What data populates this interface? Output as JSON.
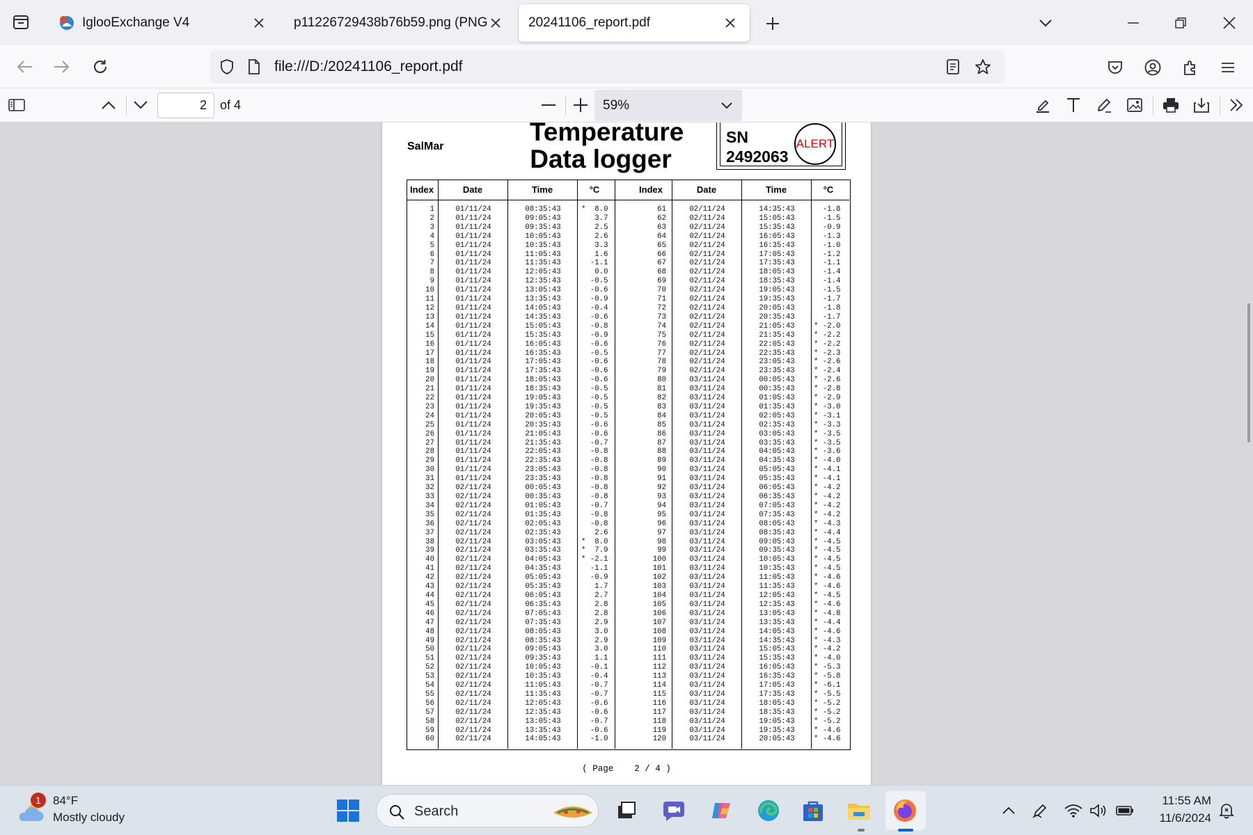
{
  "browser": {
    "tabs": [
      {
        "title": "IglooExchange V4",
        "active": false
      },
      {
        "title": "p11226729438b76b59.png (PNG Im",
        "active": false
      },
      {
        "title": "20241106_report.pdf",
        "active": true
      }
    ],
    "url": "file:///D:/20241106_report.pdf"
  },
  "pdf_toolbar": {
    "page_number": "2",
    "page_count": "of 4",
    "zoom": "59%"
  },
  "document": {
    "company": "SalMar",
    "title_line1": "Temperature",
    "title_line2": "Data logger",
    "sn_label": "SN",
    "sn_number": "2492063",
    "alert": "ALERT",
    "headers": [
      "Index",
      "Date",
      "Time",
      "°C",
      "Index",
      "Date",
      "Time",
      "°C"
    ],
    "left": {
      "index": [
        "1",
        "2",
        "3",
        "4",
        "5",
        "6",
        "7",
        "8",
        "9",
        "10",
        "11",
        "12",
        "13",
        "14",
        "15",
        "16",
        "17",
        "18",
        "19",
        "20",
        "21",
        "22",
        "23",
        "24",
        "25",
        "26",
        "27",
        "28",
        "29",
        "30",
        "31",
        "32",
        "33",
        "34",
        "35",
        "36",
        "37",
        "38",
        "39",
        "40",
        "41",
        "42",
        "43",
        "44",
        "45",
        "46",
        "47",
        "48",
        "49",
        "50",
        "51",
        "52",
        "53",
        "54",
        "55",
        "56",
        "57",
        "58",
        "59",
        "60"
      ],
      "date": [
        "01/11/24",
        "01/11/24",
        "01/11/24",
        "01/11/24",
        "01/11/24",
        "01/11/24",
        "01/11/24",
        "01/11/24",
        "01/11/24",
        "01/11/24",
        "01/11/24",
        "01/11/24",
        "01/11/24",
        "01/11/24",
        "01/11/24",
        "01/11/24",
        "01/11/24",
        "01/11/24",
        "01/11/24",
        "01/11/24",
        "01/11/24",
        "01/11/24",
        "01/11/24",
        "01/11/24",
        "01/11/24",
        "01/11/24",
        "01/11/24",
        "01/11/24",
        "01/11/24",
        "01/11/24",
        "01/11/24",
        "02/11/24",
        "02/11/24",
        "02/11/24",
        "02/11/24",
        "02/11/24",
        "02/11/24",
        "02/11/24",
        "02/11/24",
        "02/11/24",
        "02/11/24",
        "02/11/24",
        "02/11/24",
        "02/11/24",
        "02/11/24",
        "02/11/24",
        "02/11/24",
        "02/11/24",
        "02/11/24",
        "02/11/24",
        "02/11/24",
        "02/11/24",
        "02/11/24",
        "02/11/24",
        "02/11/24",
        "02/11/24",
        "02/11/24",
        "02/11/24",
        "02/11/24",
        "02/11/24"
      ],
      "time": [
        "08:35:43",
        "09:05:43",
        "09:35:43",
        "10:05:43",
        "10:35:43",
        "11:05:43",
        "11:35:43",
        "12:05:43",
        "12:35:43",
        "13:05:43",
        "13:35:43",
        "14:05:43",
        "14:35:43",
        "15:05:43",
        "15:35:43",
        "16:05:43",
        "16:35:43",
        "17:05:43",
        "17:35:43",
        "18:05:43",
        "18:35:43",
        "19:05:43",
        "19:35:43",
        "20:05:43",
        "20:35:43",
        "21:05:43",
        "21:35:43",
        "22:05:43",
        "22:35:43",
        "23:05:43",
        "23:35:43",
        "00:05:43",
        "00:35:43",
        "01:05:43",
        "01:35:43",
        "02:05:43",
        "02:35:43",
        "03:05:43",
        "03:35:43",
        "04:05:43",
        "04:35:43",
        "05:05:43",
        "05:35:43",
        "06:05:43",
        "06:35:43",
        "07:05:43",
        "07:35:43",
        "08:05:43",
        "08:35:43",
        "09:05:43",
        "09:35:43",
        "10:05:43",
        "10:35:43",
        "11:05:43",
        "11:35:43",
        "12:05:43",
        "12:35:43",
        "13:05:43",
        "13:35:43",
        "14:05:43"
      ],
      "temp": [
        "*  8.0",
        "   3.7",
        "   2.5",
        "   2.6",
        "   3.3",
        "   1.6",
        "  -1.1",
        "   0.0",
        "  -0.5",
        "  -0.6",
        "  -0.9",
        "  -0.4",
        "  -0.6",
        "  -0.8",
        "  -0.9",
        "  -0.6",
        "  -0.5",
        "  -0.6",
        "  -0.6",
        "  -0.6",
        "  -0.5",
        "  -0.5",
        "  -0.5",
        "  -0.5",
        "  -0.6",
        "  -0.6",
        "  -0.7",
        "  -0.8",
        "  -0.8",
        "  -0.8",
        "  -0.8",
        "  -0.8",
        "  -0.8",
        "  -0.7",
        "  -0.8",
        "  -0.8",
        "   2.6",
        "*  8.0",
        "*  7.9",
        "* -2.1",
        "  -1.1",
        "  -0.9",
        "   1.7",
        "   2.7",
        "   2.8",
        "   2.8",
        "   2.9",
        "   3.0",
        "   2.9",
        "   3.0",
        "   1.1",
        "  -0.1",
        "  -0.4",
        "  -0.7",
        "  -0.7",
        "  -0.6",
        "  -0.6",
        "  -0.7",
        "  -0.6",
        "  -1.0"
      ]
    },
    "right": {
      "index": [
        "61",
        "62",
        "63",
        "64",
        "65",
        "66",
        "67",
        "68",
        "69",
        "70",
        "71",
        "72",
        "73",
        "74",
        "75",
        "76",
        "77",
        "78",
        "79",
        "80",
        "81",
        "82",
        "83",
        "84",
        "85",
        "86",
        "87",
        "88",
        "89",
        "90",
        "91",
        "92",
        "93",
        "94",
        "95",
        "96",
        "97",
        "98",
        "99",
        "100",
        "101",
        "102",
        "103",
        "104",
        "105",
        "106",
        "107",
        "108",
        "109",
        "110",
        "111",
        "112",
        "113",
        "114",
        "115",
        "116",
        "117",
        "118",
        "119",
        "120"
      ],
      "date": [
        "02/11/24",
        "02/11/24",
        "02/11/24",
        "02/11/24",
        "02/11/24",
        "02/11/24",
        "02/11/24",
        "02/11/24",
        "02/11/24",
        "02/11/24",
        "02/11/24",
        "02/11/24",
        "02/11/24",
        "02/11/24",
        "02/11/24",
        "02/11/24",
        "02/11/24",
        "02/11/24",
        "02/11/24",
        "03/11/24",
        "03/11/24",
        "03/11/24",
        "03/11/24",
        "03/11/24",
        "03/11/24",
        "03/11/24",
        "03/11/24",
        "03/11/24",
        "03/11/24",
        "03/11/24",
        "03/11/24",
        "03/11/24",
        "03/11/24",
        "03/11/24",
        "03/11/24",
        "03/11/24",
        "03/11/24",
        "03/11/24",
        "03/11/24",
        "03/11/24",
        "03/11/24",
        "03/11/24",
        "03/11/24",
        "03/11/24",
        "03/11/24",
        "03/11/24",
        "03/11/24",
        "03/11/24",
        "03/11/24",
        "03/11/24",
        "03/11/24",
        "03/11/24",
        "03/11/24",
        "03/11/24",
        "03/11/24",
        "03/11/24",
        "03/11/24",
        "03/11/24",
        "03/11/24",
        "03/11/24"
      ],
      "time": [
        "14:35:43",
        "15:05:43",
        "15:35:43",
        "16:05:43",
        "16:35:43",
        "17:05:43",
        "17:35:43",
        "18:05:43",
        "18:35:43",
        "19:05:43",
        "19:35:43",
        "20:05:43",
        "20:35:43",
        "21:05:43",
        "21:35:43",
        "22:05:43",
        "22:35:43",
        "23:05:43",
        "23:35:43",
        "00:05:43",
        "00:35:43",
        "01:05:43",
        "01:35:43",
        "02:05:43",
        "02:35:43",
        "03:05:43",
        "03:35:43",
        "04:05:43",
        "04:35:43",
        "05:05:43",
        "05:35:43",
        "06:05:43",
        "06:35:43",
        "07:05:43",
        "07:35:43",
        "08:05:43",
        "08:35:43",
        "09:05:43",
        "09:35:43",
        "10:05:43",
        "10:35:43",
        "11:05:43",
        "11:35:43",
        "12:05:43",
        "12:35:43",
        "13:05:43",
        "13:35:43",
        "14:05:43",
        "14:35:43",
        "15:05:43",
        "15:35:43",
        "16:05:43",
        "16:35:43",
        "17:05:43",
        "17:35:43",
        "18:05:43",
        "18:35:43",
        "19:05:43",
        "19:35:43",
        "20:05:43"
      ],
      "temp": [
        "  -1.8",
        "  -1.5",
        "  -0.9",
        "  -1.3",
        "  -1.0",
        "  -1.2",
        "  -1.1",
        "  -1.4",
        "  -1.4",
        "  -1.5",
        "  -1.7",
        "  -1.8",
        "  -1.7",
        "* -2.0",
        "* -2.2",
        "* -2.2",
        "* -2.3",
        "* -2.6",
        "* -2.4",
        "* -2.6",
        "* -2.8",
        "* -2.9",
        "* -3.0",
        "* -3.1",
        "* -3.3",
        "* -3.5",
        "* -3.5",
        "* -3.6",
        "* -4.0",
        "* -4.1",
        "* -4.1",
        "* -4.2",
        "* -4.2",
        "* -4.2",
        "* -4.2",
        "* -4.3",
        "* -4.4",
        "* -4.5",
        "* -4.5",
        "* -4.5",
        "* -4.5",
        "* -4.6",
        "* -4.6",
        "* -4.5",
        "* -4.6",
        "* -4.8",
        "* -4.4",
        "* -4.6",
        "* -4.3",
        "* -4.2",
        "* -4.0",
        "* -5.3",
        "* -5.8",
        "* -6.1",
        "* -5.5",
        "* -5.2",
        "* -5.2",
        "* -5.2",
        "* -4.6",
        "* -4.6"
      ]
    },
    "page_footer": "( Page    2 / 4 )"
  },
  "taskbar": {
    "weather_temp": "84°F",
    "weather_desc": "Mostly cloudy",
    "weather_badge": "1",
    "search_label": "Search",
    "clock_time": "11:55 AM",
    "clock_date": "11/6/2024"
  },
  "colors": {
    "alert": "#e00000",
    "badge": "#c42b1c",
    "chrome": "#f0f0f4",
    "viewer_bg": "#d8d8dc"
  }
}
